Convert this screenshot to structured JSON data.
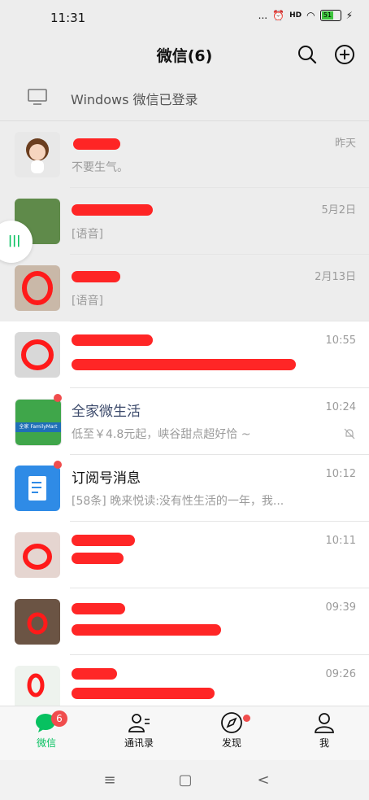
{
  "status": {
    "time": "11:31",
    "dots": "...",
    "signal_tag": "HD",
    "battery": "51"
  },
  "header": {
    "title": "微信(6)"
  },
  "device_notice": {
    "text": "Windows 微信已登录"
  },
  "chats": [
    {
      "name": "",
      "time": "昨天",
      "preview": "不要生气。"
    },
    {
      "name": "",
      "time": "5月2日",
      "preview": "[语音]"
    },
    {
      "name": "",
      "time": "2月13日",
      "preview": "[语音]"
    },
    {
      "name": "",
      "time": "10:55",
      "preview": ""
    },
    {
      "name": "全家微生活",
      "time": "10:24",
      "preview": "低至￥4.8元起，峡谷甜点超好恰 ~",
      "avatar_text": "全家 FamilyMart"
    },
    {
      "name": "订阅号消息",
      "time": "10:12",
      "preview": "[58条] 晚来悦读:没有性生活的一年，我..."
    },
    {
      "name": "",
      "time": "10:11",
      "preview": ""
    },
    {
      "name": "",
      "time": "09:39",
      "preview": ""
    },
    {
      "name": "",
      "time": "09:26",
      "preview": ""
    }
  ],
  "tabs": [
    {
      "label": "微信",
      "badge": "6"
    },
    {
      "label": "通讯录"
    },
    {
      "label": "发现"
    },
    {
      "label": "我"
    }
  ],
  "colors": {
    "accent": "#07c160",
    "badge": "#f04d4d",
    "redaction": "#ff1a1a"
  },
  "icons": {
    "nav": [
      "menu-icon",
      "home-icon",
      "back-icon"
    ],
    "nav_glyphs": [
      "≡",
      "▢",
      "<"
    ]
  }
}
